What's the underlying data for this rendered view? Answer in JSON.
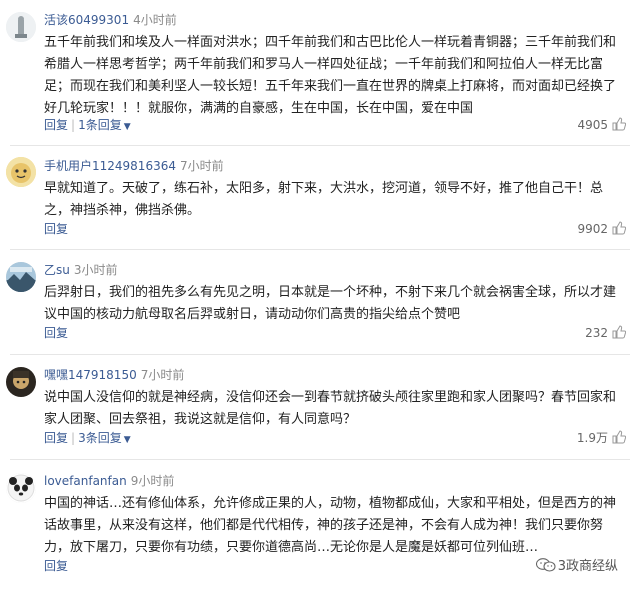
{
  "comments": [
    {
      "username": "活该60499301",
      "time": "4小时前",
      "text": "五千年前我们和埃及人一样面对洪水；四千年前我们和古巴比伦人一样玩着青铜器；三千年前我们和希腊人一样思考哲学；两千年前我们和罗马人一样四处征战；一千年前我们和阿拉伯人一样无比富足；而现在我们和美利坚人一较长短！五千年来我们一直在世界的牌桌上打麻将，而对面却已经换了好几轮玩家！！！就服你，满满的自豪感，生在中国，长在中国，爱在中国",
      "reply": "回复",
      "replies": "1条回复",
      "likes": "4905",
      "avatar_icon": "statue-avatar-icon"
    },
    {
      "username": "手机用户11249816364",
      "time": "7小时前",
      "text": "早就知道了。天破了，练石补，太阳多，射下来，大洪水，挖河道，领导不好，推了他自己干！总之，神挡杀神，佛挡杀佛。",
      "reply": "回复",
      "likes": "9902",
      "avatar_icon": "cartoon-face-avatar-icon"
    },
    {
      "username": "乙su",
      "time": "3小时前",
      "text": "后羿射日，我们的祖先多么有先见之明，日本就是一个坏种，不射下来几个就会祸害全球，所以才建议中国的核动力航母取名后羿或射日，请动动你们高贵的指尖给点个赞吧",
      "reply": "回复",
      "likes": "232",
      "avatar_icon": "landscape-avatar-icon"
    },
    {
      "username": "嘿嘿147918150",
      "time": "7小时前",
      "text": "说中国人没信仰的就是神经病，没信仰还会一到春节就挤破头颅往家里跑和家人团聚吗？春节回家和家人团聚、回去祭祖，我说这就是信仰，有人同意吗？",
      "reply": "回复",
      "replies": "3条回复",
      "likes": "1.9万",
      "avatar_icon": "dark-character-avatar-icon"
    },
    {
      "username": "lovefanfanfan",
      "time": "9小时前",
      "text": "中国的神话…还有修仙体系，允许修成正果的人，动物，植物都成仙，大家和平相处，但是西方的神话故事里，从来没有这样，他们都是代代相传，神的孩子还是神，不会有人成为神！我们只要你努力，放下屠刀，只要你有功绩，只要你道德高尚…无论你是人是魔是妖都可位列仙班…",
      "reply": "回复",
      "avatar_icon": "panda-avatar-icon"
    }
  ],
  "watermark": "3政商经纵"
}
